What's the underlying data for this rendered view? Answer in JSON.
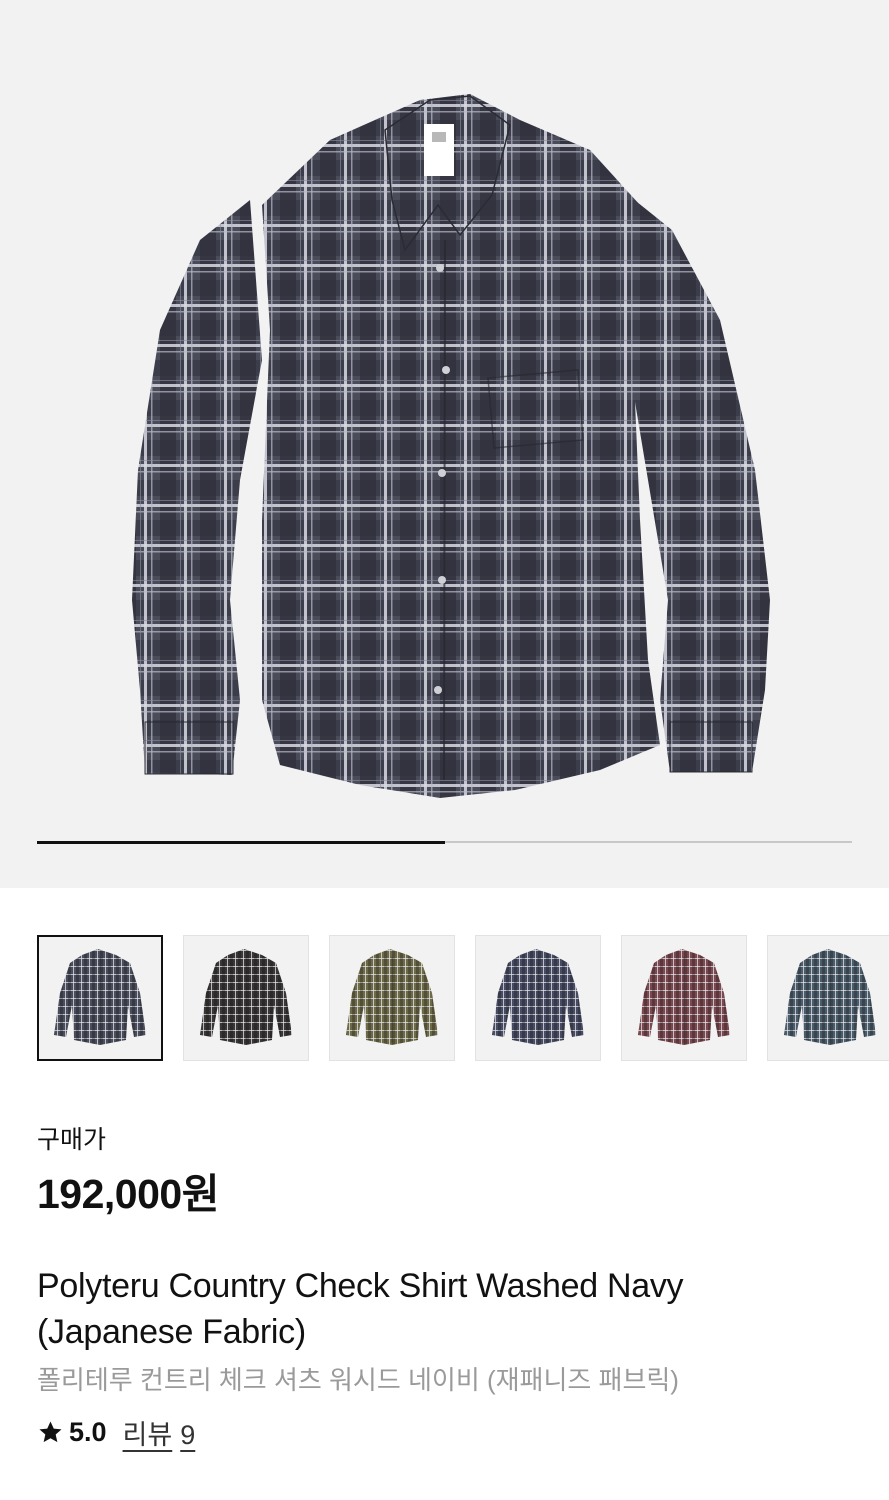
{
  "gallery": {
    "main_image_alt": "Polyteru Country Check Shirt Washed Navy",
    "progress": 0.5,
    "thumbnails": [
      {
        "name": "navy-check",
        "color": "#4a4d5c",
        "selected": true
      },
      {
        "name": "black-check",
        "color": "#3a3836",
        "selected": false
      },
      {
        "name": "olive-check",
        "color": "#6d6a48",
        "selected": false
      },
      {
        "name": "navy-check-2",
        "color": "#484c62",
        "selected": false
      },
      {
        "name": "burgundy-check",
        "color": "#7a4a50",
        "selected": false
      },
      {
        "name": "blue-check",
        "color": "#4b5c6a",
        "selected": false
      }
    ]
  },
  "product": {
    "price_label": "구매가",
    "price": "192,000원",
    "title": "Polyteru Country Check Shirt Washed Navy (Japanese Fabric)",
    "subtitle": "폴리테루 컨트리 체크 셔츠 워시드 네이비 (재패니즈 패브릭)",
    "rating": "5.0",
    "review_label": "리뷰",
    "review_count": "9"
  },
  "icons": {
    "rating": "star-icon"
  },
  "colors": {
    "hero_background": "#f2f2f2",
    "text_primary": "#111111",
    "text_secondary": "#9a9a9a"
  }
}
